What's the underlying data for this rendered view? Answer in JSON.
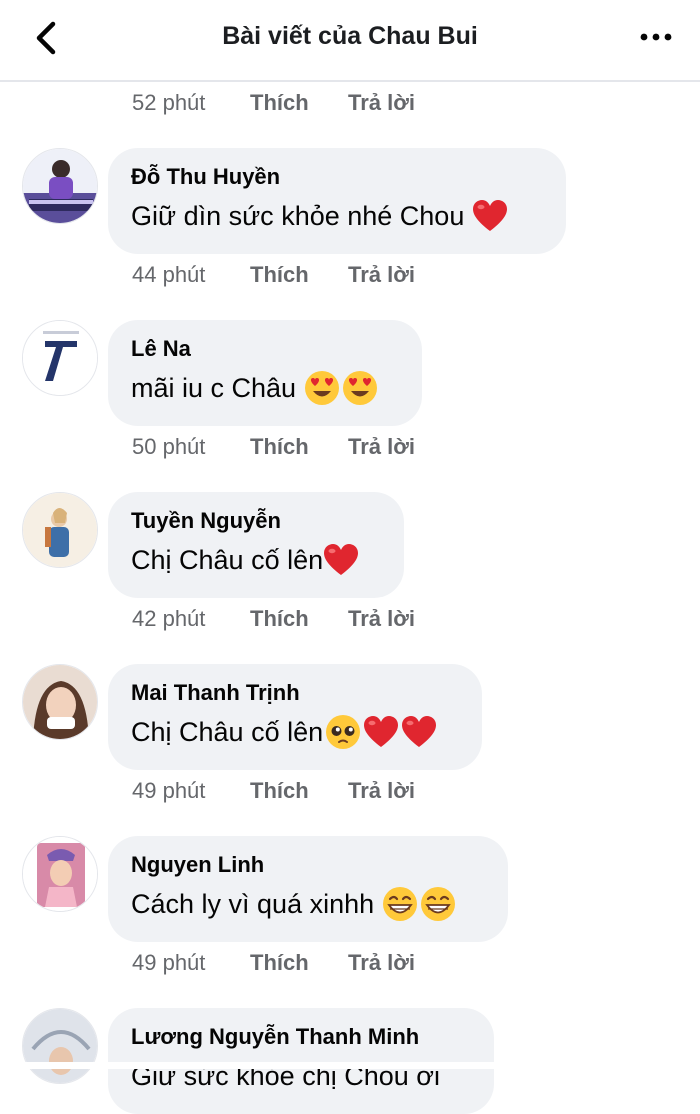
{
  "header": {
    "title": "Bài viết của Chau Bui"
  },
  "meta": {
    "like": "Thích",
    "reply": "Trả lời"
  },
  "top_meta": {
    "time": "52 phút"
  },
  "comments": [
    {
      "author": "Đỗ Thu Huyền",
      "text": "Giữ dìn sức khỏe nhé Chou",
      "emojis": [
        "red-heart"
      ],
      "time": "44 phút"
    },
    {
      "author": "Lê Na",
      "text": "mãi iu c Châu",
      "emojis": [
        "heart-eyes",
        "heart-eyes"
      ],
      "time": "50 phút"
    },
    {
      "author": "Tuyền Nguyễn",
      "text": "Chị Châu cố lên",
      "emojis": [
        "red-heart"
      ],
      "time": "42 phút"
    },
    {
      "author": "Mai Thanh Trịnh",
      "text": "Chị Châu cố lên",
      "emojis": [
        "pleading-face",
        "red-heart",
        "red-heart"
      ],
      "time": "49 phút"
    },
    {
      "author": "Nguyen Linh",
      "text": "Cách ly vì quá xinhh",
      "emojis": [
        "grinning-face",
        "grinning-face"
      ],
      "time": "49 phút"
    },
    {
      "author": "Lương Nguyễn Thanh Minh",
      "text": "Giữ sức khỏe chị Chou ơi",
      "emojis": [],
      "time": ""
    }
  ],
  "colors": {
    "bubble": "#f0f2f5",
    "meta": "#65676b",
    "heart": "#e0262f",
    "emoji_yellow": "#ffc93a"
  }
}
